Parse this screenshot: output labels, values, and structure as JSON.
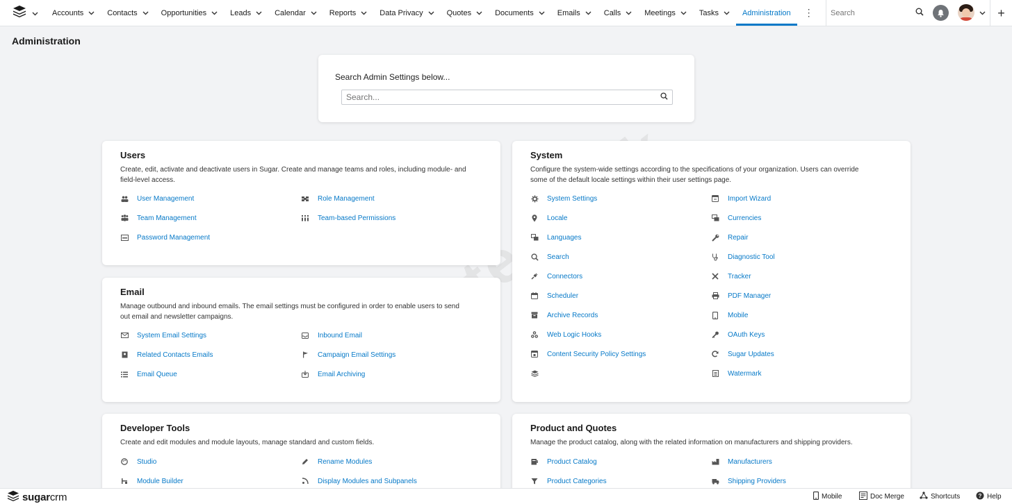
{
  "nav": {
    "items": [
      {
        "label": "Accounts",
        "name": "nav-accounts"
      },
      {
        "label": "Contacts",
        "name": "nav-contacts"
      },
      {
        "label": "Opportunities",
        "name": "nav-opportunities"
      },
      {
        "label": "Leads",
        "name": "nav-leads"
      },
      {
        "label": "Calendar",
        "name": "nav-calendar"
      },
      {
        "label": "Reports",
        "name": "nav-reports"
      },
      {
        "label": "Data Privacy",
        "name": "nav-data-privacy"
      },
      {
        "label": "Quotes",
        "name": "nav-quotes"
      },
      {
        "label": "Documents",
        "name": "nav-documents"
      },
      {
        "label": "Emails",
        "name": "nav-emails"
      },
      {
        "label": "Calls",
        "name": "nav-calls"
      },
      {
        "label": "Meetings",
        "name": "nav-meetings"
      },
      {
        "label": "Tasks",
        "name": "nav-tasks"
      }
    ],
    "active_label": "Administration",
    "search_placeholder": "Search"
  },
  "page": {
    "title": "Administration"
  },
  "admin_search": {
    "label": "Search Admin Settings below...",
    "placeholder": "Search..."
  },
  "watermark": "Watermark",
  "sections": {
    "users": {
      "title": "Users",
      "desc1": "Create, edit, activate and deactivate users in Sugar. Create and manage teams and roles, including module- and",
      "desc2": "field-level access.",
      "links": [
        "User Management",
        "Role Management",
        "Team Management",
        "Team-based Permissions",
        "Password Management"
      ]
    },
    "email": {
      "title": "Email",
      "desc1": "Manage outbound and inbound emails. The email settings must be configured in order to enable users to send",
      "desc2": "out email and newsletter campaigns.",
      "links": [
        "System Email Settings",
        "Inbound Email",
        "Related Contacts Emails",
        "Campaign Email Settings",
        "Email Queue",
        "Email Archiving"
      ]
    },
    "developer": {
      "title": "Developer Tools",
      "desc1": "Create and edit modules and module layouts, manage standard and custom fields.",
      "links": [
        "Studio",
        "Rename Modules",
        "Module Builder",
        "Display Modules and Subpanels"
      ]
    },
    "system": {
      "title": "System",
      "desc1": "Configure the system-wide settings according to the specifications of your organization. Users can override",
      "desc2": "some of the default locale settings within their user settings page.",
      "links": [
        "System Settings",
        "Import Wizard",
        "Locale",
        "Currencies",
        "Languages",
        "Repair",
        "Search",
        "Diagnostic Tool",
        "Connectors",
        "Tracker",
        "Scheduler",
        "PDF Manager",
        "Archive Records",
        "Mobile",
        "Web Logic Hooks",
        "OAuth Keys",
        "Content Security Policy Settings",
        "Sugar Updates",
        "",
        "Watermark"
      ]
    },
    "products": {
      "title": "Product and Quotes",
      "desc1": "Manage the product catalog, along with the related information on manufacturers and shipping providers.",
      "links": [
        "Product Catalog",
        "Manufacturers",
        "Product Categories",
        "Shipping Providers"
      ]
    }
  },
  "footer": {
    "brand_bold": "sugar",
    "brand_rest": "crm",
    "mobile": "Mobile",
    "doc_merge": "Doc Merge",
    "shortcuts": "Shortcuts",
    "help": "Help"
  }
}
